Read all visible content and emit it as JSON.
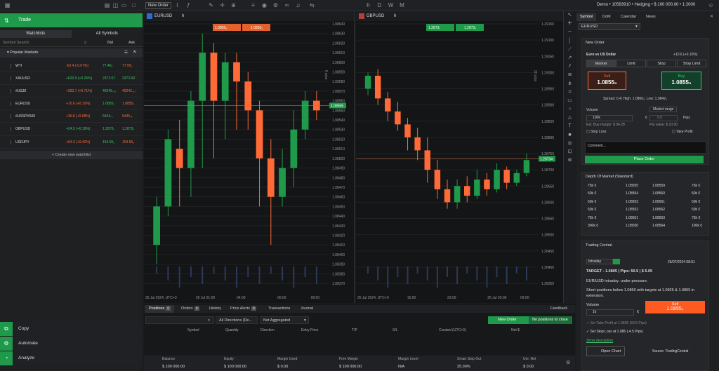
{
  "topbar": {
    "new_order": "New Order",
    "account": "Demo • 10583910 • Hedging • $ 100 000.00 • 1:2000"
  },
  "left": {
    "trade": "Trade",
    "tabs": [
      "Watchlists",
      "All Symbols"
    ],
    "search_placeholder": "Symbol Search",
    "bid": "Bid",
    "ask": "Ask",
    "section": "Popular Markets",
    "rows": [
      {
        "name": "WTI",
        "change": "-52.4 (-0.67%)",
        "bid": "77.46₂",
        "ask": "77.55₂",
        "dir": "dn"
      },
      {
        "name": "XAUUSD",
        "change": "+620.9 (+0.26%)",
        "bid": "2372.67",
        "ask": "2372.69",
        "dir": "up"
      },
      {
        "name": "#US30",
        "change": "+283.7 (+0.71%)",
        "bid": "40245.₀₂",
        "ask": "40242.₀₂",
        "dir": "dn"
      },
      {
        "name": "EURUSD",
        "change": "+10.6 (+0.10%)",
        "bid": "1.0855₃",
        "ask": "1.0855₃",
        "dir": "dn"
      },
      {
        "name": "#USSPX500",
        "change": "+36.8 (+0.68%)",
        "bid": "5444.₉",
        "ask": "5445.₈",
        "dir": "dn"
      },
      {
        "name": "GBPUSD",
        "change": "+24.3 (+0.19%)",
        "bid": "1.2873₃",
        "ask": "1.2873₃",
        "dir": "up"
      },
      {
        "name": "USDJPY",
        "change": "+64.3 (+0.42%)",
        "bid": "154.55₁",
        "ask": "154.56₀",
        "dir": "dn"
      }
    ],
    "create": "+ Create new watchlist",
    "bottom": [
      "Copy",
      "Automate",
      "Analyze"
    ]
  },
  "charts": [
    {
      "symbol": "EURUSD",
      "tf": "h",
      "sell": "1.0855₅",
      "buy": "1.0855₅",
      "pips": "5 pips",
      "prices": [
        "1.08640",
        "1.08630",
        "1.08620",
        "1.08610",
        "1.08600",
        "1.08590",
        "1.08580",
        "1.08570",
        "1.08560",
        "1.08550",
        "1.08540",
        "1.08530",
        "1.08520",
        "1.08510",
        "1.08500",
        "1.08490",
        "1.08480",
        "1.08470",
        "1.08460",
        "1.08450",
        "1.08440",
        "1.08430",
        "1.08420",
        "1.08410",
        "1.08400",
        "1.08390",
        "1.08380",
        "1.08370"
      ],
      "times": [
        "25 Jul 2024, UTC+0",
        "26 Jul 01:00",
        "04:00",
        "06:00",
        "09:00"
      ],
      "last": "1.08555",
      "candles": [
        [
          1.0841,
          1.0845,
          1.0846,
          1.0839
        ],
        [
          1.0845,
          1.0852,
          1.0853,
          1.0844
        ],
        [
          1.0851,
          1.0849,
          1.0854,
          1.0845
        ],
        [
          1.0849,
          1.0856,
          1.0857,
          1.0846
        ],
        [
          1.0856,
          1.0861,
          1.0863,
          1.0849
        ],
        [
          1.0861,
          1.0856,
          1.0862,
          1.085
        ],
        [
          1.0856,
          1.086,
          1.0861,
          1.0852
        ],
        [
          1.086,
          1.0858,
          1.0861,
          1.0853
        ],
        [
          1.0858,
          1.0855,
          1.0859,
          1.0853
        ],
        [
          1.0855,
          1.085,
          1.0856,
          1.0845
        ],
        [
          1.085,
          1.0846,
          1.0852,
          1.0841
        ],
        [
          1.0846,
          1.0849,
          1.0851,
          1.0845
        ],
        [
          1.0849,
          1.0853,
          1.0855,
          1.0847
        ],
        [
          1.0853,
          1.0856,
          1.0857,
          1.0852
        ],
        [
          1.0856,
          1.0855,
          1.0857,
          1.0854
        ]
      ]
    },
    {
      "symbol": "GBPUSD",
      "tf": "h",
      "sell": "1.2873₂",
      "buy": "1.2873₂",
      "pips": "20 pips",
      "prices": [
        "1.29150",
        "1.29100",
        "1.29050",
        "1.29000",
        "1.28950",
        "1.28900",
        "1.28850",
        "1.28800",
        "1.28750",
        "1.28700",
        "1.28650",
        "1.28600",
        "1.28550",
        "1.28500",
        "1.28450",
        "1.28400",
        "1.28350"
      ],
      "times": [
        "25 Jul 2024, UTC+0",
        "15:00",
        "23:00",
        "26 Jul 03:00",
        "09:00"
      ],
      "last": "1.28734",
      "candles": [
        [
          1.2895,
          1.2899,
          1.29,
          1.2893
        ],
        [
          1.2899,
          1.2892,
          1.2901,
          1.289
        ],
        [
          1.2892,
          1.2888,
          1.2894,
          1.2885
        ],
        [
          1.2888,
          1.2884,
          1.2891,
          1.2882
        ],
        [
          1.2884,
          1.288,
          1.2886,
          1.2876
        ],
        [
          1.288,
          1.2876,
          1.2883,
          1.2873
        ],
        [
          1.2876,
          1.287,
          1.288,
          1.2866
        ],
        [
          1.287,
          1.2864,
          1.2873,
          1.2861
        ],
        [
          1.2864,
          1.286,
          1.2867,
          1.2858
        ],
        [
          1.286,
          1.2865,
          1.2867,
          1.2858
        ],
        [
          1.2865,
          1.2862,
          1.2868,
          1.286
        ],
        [
          1.2862,
          1.2867,
          1.287,
          1.2861
        ],
        [
          1.2867,
          1.2864,
          1.2869,
          1.2862
        ],
        [
          1.2864,
          1.287,
          1.2872,
          1.2863
        ],
        [
          1.287,
          1.2866,
          1.2871,
          1.2864
        ],
        [
          1.2866,
          1.2869,
          1.287,
          1.2865
        ],
        [
          1.2869,
          1.2873,
          1.2875,
          1.2868
        ]
      ]
    }
  ],
  "bottom": {
    "tabs": [
      {
        "label": "Positions",
        "count": "0"
      },
      {
        "label": "Orders",
        "count": "0"
      },
      {
        "label": "History",
        "count": ""
      },
      {
        "label": "Price Alerts",
        "count": "0"
      },
      {
        "label": "Transactions",
        "count": ""
      },
      {
        "label": "Journal",
        "count": ""
      }
    ],
    "feedback": "Feedback",
    "dir_filter": "All Directions (De...",
    "agg_filter": "Not Aggregated",
    "new_order": "New Order",
    "no_pos": "No positions to close",
    "cols": [
      "Symbol",
      "Quantity",
      "Direction",
      "Entry Price",
      "T/P",
      "S/L",
      "Created (UTC+0)",
      "Net $"
    ],
    "summary": [
      {
        "l": "Balance",
        "v": "$ 100 000.00"
      },
      {
        "l": "Equity",
        "v": "$ 100 000.00"
      },
      {
        "l": "Margin Used",
        "v": "$ 0.00"
      },
      {
        "l": "Free Margin",
        "v": "$ 100 000.00"
      },
      {
        "l": "Margin Level",
        "v": "N/A"
      },
      {
        "l": "Smart Stop Out",
        "v": "25.00%"
      },
      {
        "l": "Unr. Net",
        "v": "$ 0.00"
      }
    ]
  },
  "right": {
    "tabs": [
      "Symbol",
      "DoM",
      "Calendar",
      "News"
    ],
    "symbol": "EURUSD",
    "new_order": "New Order",
    "pair": "Euro vs US Dollar",
    "pair_change": "+10.6 (+0.10%)",
    "types": [
      "Market",
      "Limit",
      "Stop",
      "Stop Limit"
    ],
    "sell": "Sell",
    "sell_p": "1.0855₅",
    "buy": "Buy",
    "buy_p": "1.0855₅",
    "spread": "Spread: 0.4; High: 1.0860₂; Low: 1.0842₃",
    "volume": "Volume",
    "vol_val": "100k",
    "vol_unit": "€",
    "mrange": "Market range",
    "mr_val": "5.0",
    "pips": "Pips",
    "est": "Est. Buy margin: $ 54.28",
    "pipval": "Pip value: $ 10.00",
    "stoploss": "Stop Loss",
    "takeprofit": "Take Profit",
    "comment": "Comment...",
    "place": "Place Order",
    "dom_title": "Depth Of Market (Standard)",
    "dom": [
      [
        "75k €",
        "1.08555",
        "1.08559",
        "75k €"
      ],
      [
        "50k €",
        "1.08554",
        "1.08560",
        "50k €"
      ],
      [
        "50k €",
        "1.08553",
        "1.08561",
        "50k €"
      ],
      [
        "50k €",
        "1.08552",
        "1.08562",
        "50k €"
      ],
      [
        "75k €",
        "1.08551",
        "1.08563",
        "75k €"
      ],
      [
        "300k €",
        "1.08550",
        "1.08564",
        "100k €"
      ]
    ],
    "tc_title": "Trading Central",
    "tc_period": "Intraday",
    "tc_date": "26/07/2024 08:51",
    "tc_target": "TARGET  - 1.0805  |  Pips: 50.5  |  $ 5.05",
    "tc_line1": "EUR/USD intraday: under pressure.",
    "tc_line2": "Short positions below 1.0860 with targets at 1.0825 & 1.0805 in extension.",
    "tc_vol": "Volume",
    "tc_vol_val": "1k",
    "tc_sell": "Sell",
    "tc_sell_p": "1.0855₅",
    "tc_tp": "Set Take Profit at 1.0805  (50.5 Pips)",
    "tc_sl": "Set Stop Loss at 1.086  (-4.5 Pips)",
    "tc_show": "Show description",
    "tc_open": "Open Chart",
    "tc_src": "Source: TradingCentral"
  },
  "colors": {
    "green": "#1e9a4a",
    "up": "#3ec66b",
    "down": "#ff6a36"
  }
}
